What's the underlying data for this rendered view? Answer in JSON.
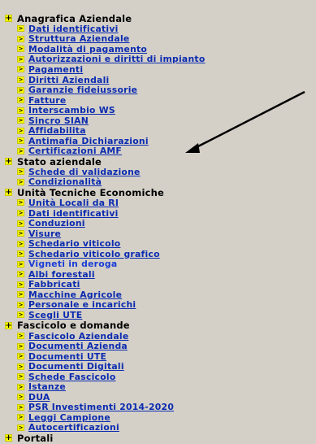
{
  "sections": [
    {
      "label": "Anagrafica Aziendale",
      "items": [
        {
          "label": "Dati identificativi",
          "underline": true
        },
        {
          "label": "Struttura Aziendale",
          "underline": true
        },
        {
          "label": "Modalità di pagamento",
          "underline": true
        },
        {
          "label": "Autorizzazioni e diritti di impianto",
          "underline": true
        },
        {
          "label": "Pagamenti",
          "underline": true
        },
        {
          "label": "Diritti Aziendali",
          "underline": true
        },
        {
          "label": "Garanzie fideiussorie",
          "underline": true
        },
        {
          "label": "Fatture",
          "underline": true
        },
        {
          "label": "Interscambio WS",
          "underline": true
        },
        {
          "label": "Sincro SIAN",
          "underline": true
        },
        {
          "label": "Affidabilita",
          "underline": true
        },
        {
          "label": "Antimafia Dichiarazioni",
          "underline": true
        },
        {
          "label": "Certificazioni AMF",
          "underline": true
        }
      ]
    },
    {
      "label": "Stato aziendale",
      "items": [
        {
          "label": "Schede di validazione",
          "underline": true
        },
        {
          "label": "Condizionalità",
          "underline": true
        }
      ]
    },
    {
      "label": "Unità Tecniche Economiche",
      "items": [
        {
          "label": "Unità Locali da RI",
          "underline": true
        },
        {
          "label": "Dati identificativi",
          "underline": true
        },
        {
          "label": "Conduzioni",
          "underline": true
        },
        {
          "label": "Visure",
          "underline": true
        },
        {
          "label": "Schedario viticolo",
          "underline": true
        },
        {
          "label": "Schedario viticolo grafico",
          "underline": true
        },
        {
          "label": "Vigneti in deroga",
          "underline": false
        },
        {
          "label": "Albi forestali",
          "underline": true
        },
        {
          "label": "Fabbricati",
          "underline": true
        },
        {
          "label": "Macchine Agricole",
          "underline": true
        },
        {
          "label": "Personale e incarichi",
          "underline": true
        },
        {
          "label": "Scegli UTE",
          "underline": true
        }
      ]
    },
    {
      "label": "Fascicolo e domande",
      "items": [
        {
          "label": "Fascicolo Aziendale",
          "underline": true
        },
        {
          "label": "Documenti Azienda",
          "underline": true
        },
        {
          "label": "Documenti UTE",
          "underline": true
        },
        {
          "label": "Documenti Digitali",
          "underline": true
        },
        {
          "label": "Schede Fascicolo",
          "underline": true
        },
        {
          "label": "Istanze",
          "underline": true
        },
        {
          "label": "DUA",
          "underline": true
        },
        {
          "label": "PSR Investimenti 2014-2020",
          "underline": true
        },
        {
          "label": "Leggi Campione",
          "underline": true
        },
        {
          "label": "Autocertificazioni",
          "underline": true
        }
      ]
    },
    {
      "label": "Portali",
      "items": []
    }
  ],
  "icons": {
    "section_toggle": "plus-icon",
    "item_bullet": "arrow-right-icon",
    "annotation": "pointer-arrow"
  },
  "colors": {
    "background": "#d4d0c8",
    "link": "#0b2bb0",
    "icon_fill": "#ffff00",
    "annotation": "#000000"
  }
}
